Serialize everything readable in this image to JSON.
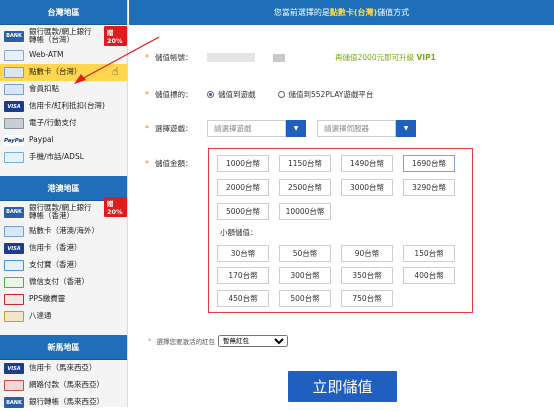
{
  "sidebar": {
    "tw_title": "台灣地區",
    "tw_items": [
      {
        "icon": "BANK",
        "label": "銀行匯款/網上銀行\n轉帳（台灣）"
      },
      {
        "icon": "ATM",
        "label": "Web-ATM"
      },
      {
        "icon": "",
        "label": "點數卡（台灣）"
      },
      {
        "icon": "",
        "label": "會員扣點"
      },
      {
        "icon": "VISA",
        "label": "信用卡/紅利抵扣(台灣)"
      },
      {
        "icon": "",
        "label": "電子/行動支付"
      },
      {
        "icon": "PayPal",
        "label": "Paypal"
      },
      {
        "icon": "",
        "label": "手機/市話/ADSL"
      }
    ],
    "hk_title": "港澳地區",
    "hk_items": [
      {
        "icon": "BANK",
        "label": "銀行匯款/網上銀行\n轉帳（香港）"
      },
      {
        "icon": "",
        "label": "點數卡（港澳/海外）"
      },
      {
        "icon": "VISA",
        "label": "信用卡（香港）"
      },
      {
        "icon": "",
        "label": "支付寶（香港）"
      },
      {
        "icon": "",
        "label": "微信支付（香港）"
      },
      {
        "icon": "",
        "label": "PPS繳費靈"
      },
      {
        "icon": "",
        "label": "八達通"
      }
    ],
    "sg_title": "新馬地區",
    "sg_items": [
      {
        "icon": "VISA",
        "label": "信用卡（馬來西亞）"
      },
      {
        "icon": "",
        "label": "網路付款（馬來西亞）"
      },
      {
        "icon": "BANK",
        "label": "銀行轉帳（馬來西亞）"
      }
    ],
    "badge_tw": "贈20%",
    "badge_hk": "贈20%"
  },
  "header": {
    "prefix": "您當前選擇的是 ",
    "method": "點數卡(台灣)",
    "suffix": " 儲值方式"
  },
  "form": {
    "account_label": "儲值帳號：",
    "upgrade_prefix": "再儲值2000元即可升級 ",
    "vip_level": "VIP1",
    "target_label": "儲值標的：",
    "target_opt1": "儲值到遊戲",
    "target_opt2": "儲值到552PLAY遊戲平台",
    "game_label": "選擇遊戲：",
    "game_placeholder": "請選擇遊戲",
    "server_placeholder": "請選擇伺服器",
    "amount_label": "儲值金額：",
    "amounts": [
      "1000台幣",
      "1150台幣",
      "1490台幣",
      "1690台幣",
      "2000台幣",
      "2500台幣",
      "3000台幣",
      "3290台幣",
      "5000台幣",
      "10000台幣"
    ],
    "selected_amount": "1690台幣",
    "small_title": "小額儲值：",
    "small_amounts": [
      "30台幣",
      "50台幣",
      "90台幣",
      "150台幣",
      "170台幣",
      "300台幣",
      "350台幣",
      "400台幣",
      "450台幣",
      "500台幣",
      "750台幣"
    ],
    "coupon_label": "選擇您要激活的紅包",
    "coupon_value": "暫無紅包",
    "submit_label": "立即儲值"
  }
}
